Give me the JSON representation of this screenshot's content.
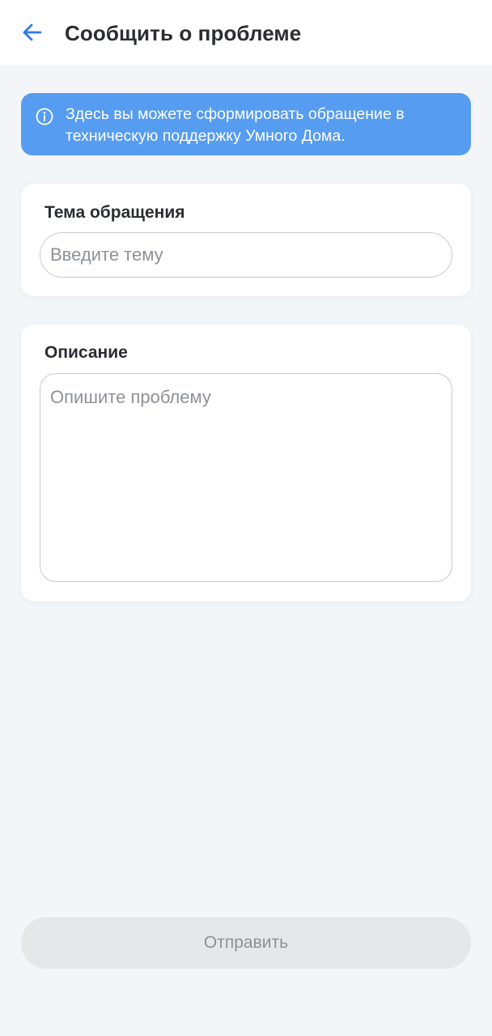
{
  "app_bar": {
    "title": "Сообщить о проблеме",
    "back_icon": "arrow-left-icon",
    "accent_color": "#2f7be5"
  },
  "info_banner": {
    "icon": "info-circle-icon",
    "text": "Здесь вы можете сформировать обращение в техническую поддержку Умного Дома.",
    "background_color": "#569cf0"
  },
  "topic_field": {
    "label": "Тема обращения",
    "value": "",
    "placeholder": "Введите тему"
  },
  "description_field": {
    "label": "Описание",
    "value": "",
    "placeholder": "Опишите проблему"
  },
  "submit_button": {
    "label": "Отправить",
    "state": "disabled"
  }
}
